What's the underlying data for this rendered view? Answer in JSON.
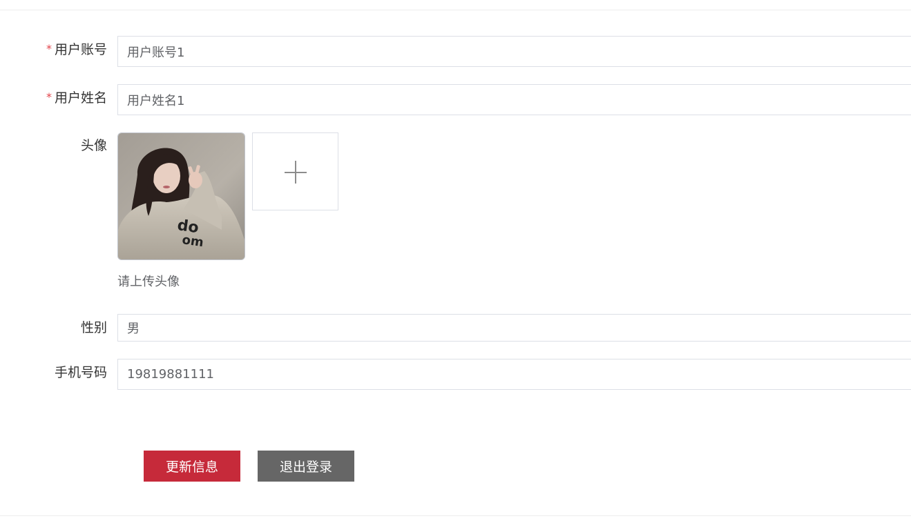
{
  "form": {
    "account": {
      "required_mark": "*",
      "label": "用户账号",
      "value": "用户账号1"
    },
    "name": {
      "required_mark": "*",
      "label": "用户姓名",
      "value": "用户姓名1"
    },
    "avatar": {
      "label": "头像",
      "hint": "请上传头像",
      "upload_icon": "plus-icon"
    },
    "gender": {
      "label": "性别",
      "value": "男"
    },
    "phone": {
      "label": "手机号码",
      "value": "19819881111"
    }
  },
  "actions": {
    "update_label": "更新信息",
    "logout_label": "退出登录"
  },
  "colors": {
    "required": "#e2434a",
    "update_button": "#c62a3a",
    "logout_button": "#666666",
    "border": "#dcdfe6"
  }
}
